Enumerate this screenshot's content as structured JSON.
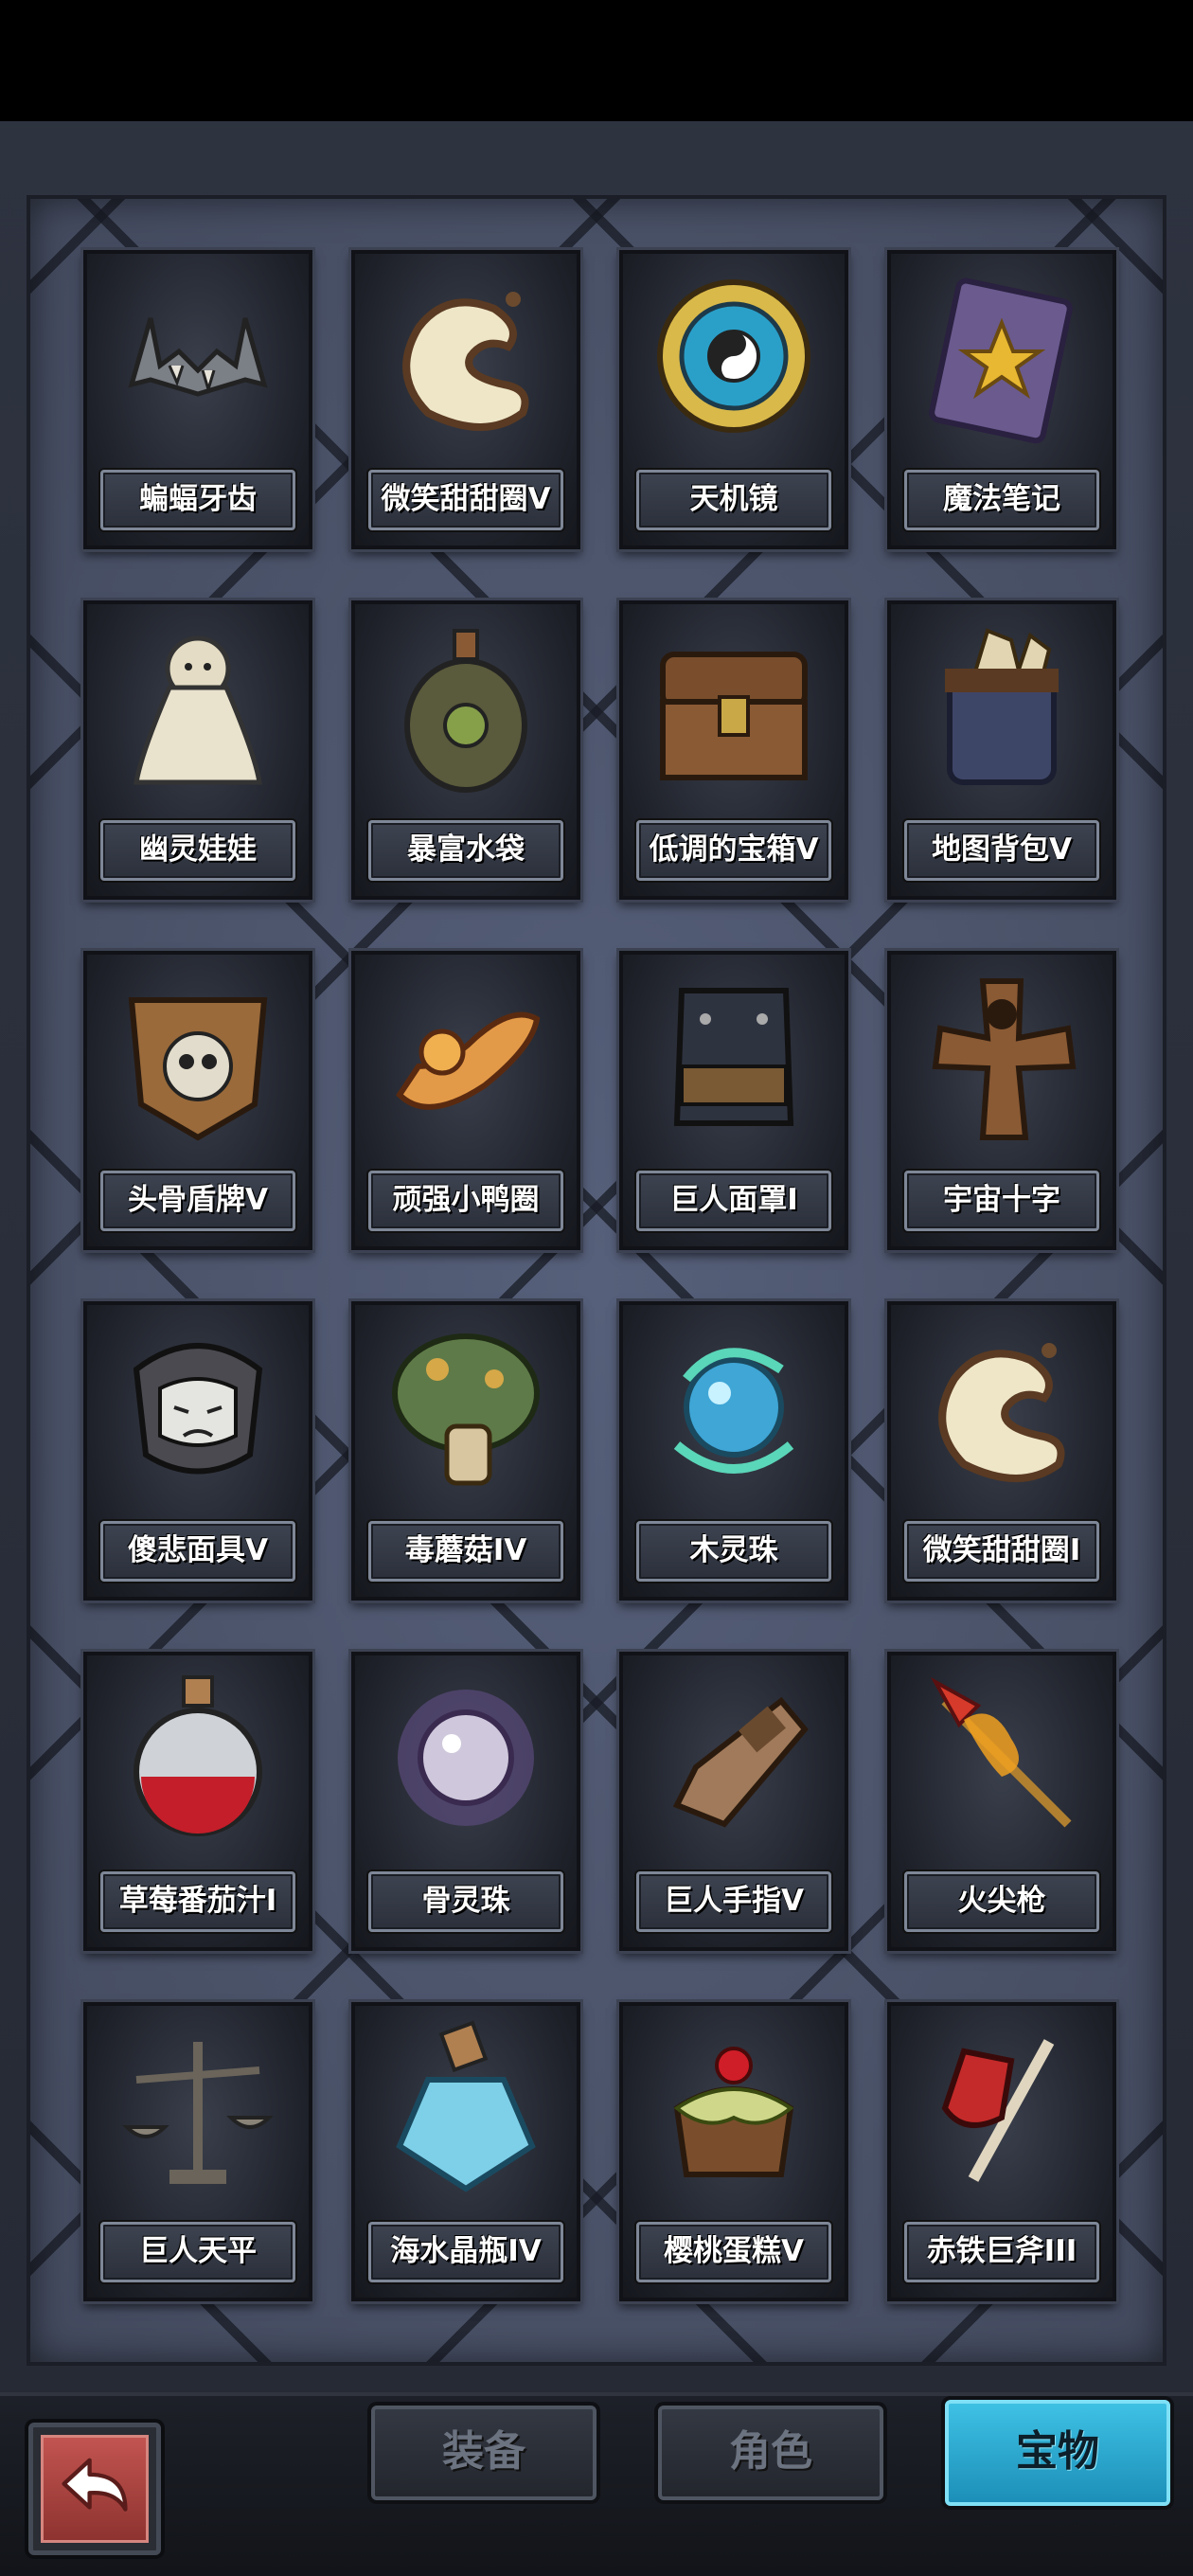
{
  "items": [
    {
      "name": "蝙蝠牙齿",
      "icon": "bat-fangs-icon"
    },
    {
      "name": "微笑甜甜圈V",
      "icon": "smile-donut-icon"
    },
    {
      "name": "天机镜",
      "icon": "yin-yang-mirror-icon"
    },
    {
      "name": "魔法笔记",
      "icon": "magic-book-icon"
    },
    {
      "name": "幽灵娃娃",
      "icon": "ghost-doll-icon"
    },
    {
      "name": "暴富水袋",
      "icon": "water-pouch-icon"
    },
    {
      "name": "低调的宝箱V",
      "icon": "treasure-chest-icon"
    },
    {
      "name": "地图背包V",
      "icon": "map-backpack-icon"
    },
    {
      "name": "头骨盾牌V",
      "icon": "skull-shield-icon"
    },
    {
      "name": "顽强小鸭圈",
      "icon": "duck-ring-icon"
    },
    {
      "name": "巨人面罩I",
      "icon": "giant-mask-icon"
    },
    {
      "name": "宇宙十字",
      "icon": "cosmic-cross-icon"
    },
    {
      "name": "傻悲面具V",
      "icon": "sad-mask-icon"
    },
    {
      "name": "毒蘑菇IV",
      "icon": "poison-mushroom-icon"
    },
    {
      "name": "木灵珠",
      "icon": "wood-spirit-orb-icon"
    },
    {
      "name": "微笑甜甜圈I",
      "icon": "smile-donut-icon"
    },
    {
      "name": "草莓番茄汁I",
      "icon": "red-potion-icon"
    },
    {
      "name": "骨灵珠",
      "icon": "bone-spirit-orb-icon"
    },
    {
      "name": "巨人手指V",
      "icon": "giant-finger-icon"
    },
    {
      "name": "火尖枪",
      "icon": "fire-spear-icon"
    },
    {
      "name": "巨人天平",
      "icon": "giant-scale-icon"
    },
    {
      "name": "海水晶瓶IV",
      "icon": "crystal-bottle-icon"
    },
    {
      "name": "樱桃蛋糕V",
      "icon": "cherry-cake-icon"
    },
    {
      "name": "赤铁巨斧III",
      "icon": "red-iron-axe-icon"
    }
  ],
  "tabs": {
    "equip": "装备",
    "character": "角色",
    "treasure": "宝物"
  },
  "active_tab": "treasure",
  "back_icon": "return-arrow-icon",
  "colors": {
    "panel": "#4a5267",
    "active_tab": "#2ea9d2",
    "back_button": "#b04643"
  }
}
